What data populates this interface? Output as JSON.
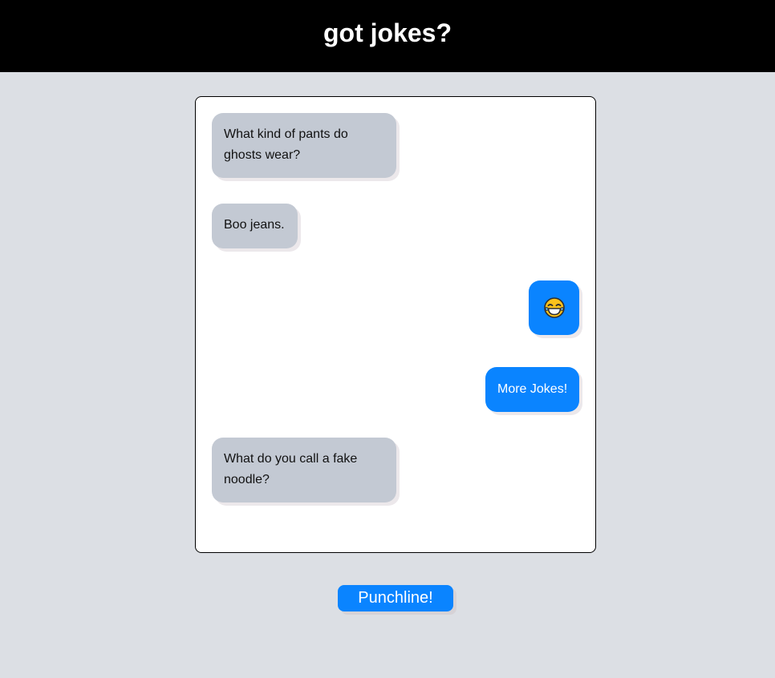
{
  "header": {
    "title": "got jokes?"
  },
  "chat": {
    "messages": [
      {
        "from": "bot",
        "text": "What kind of pants do ghosts wear?"
      },
      {
        "from": "bot",
        "text": "Boo jeans."
      },
      {
        "from": "user",
        "icon": "laughing-tears-emoji-icon"
      },
      {
        "from": "user",
        "text": "More Jokes!"
      },
      {
        "from": "bot",
        "text": "What do you call a fake noodle?"
      }
    ]
  },
  "actions": {
    "punchline_label": "Punchline!"
  },
  "colors": {
    "header_bg": "#000000",
    "page_bg": "#dcdfe4",
    "bot_bubble": "#c3c9d3",
    "user_bubble": "#0a84ff",
    "button": "#0a84ff"
  }
}
